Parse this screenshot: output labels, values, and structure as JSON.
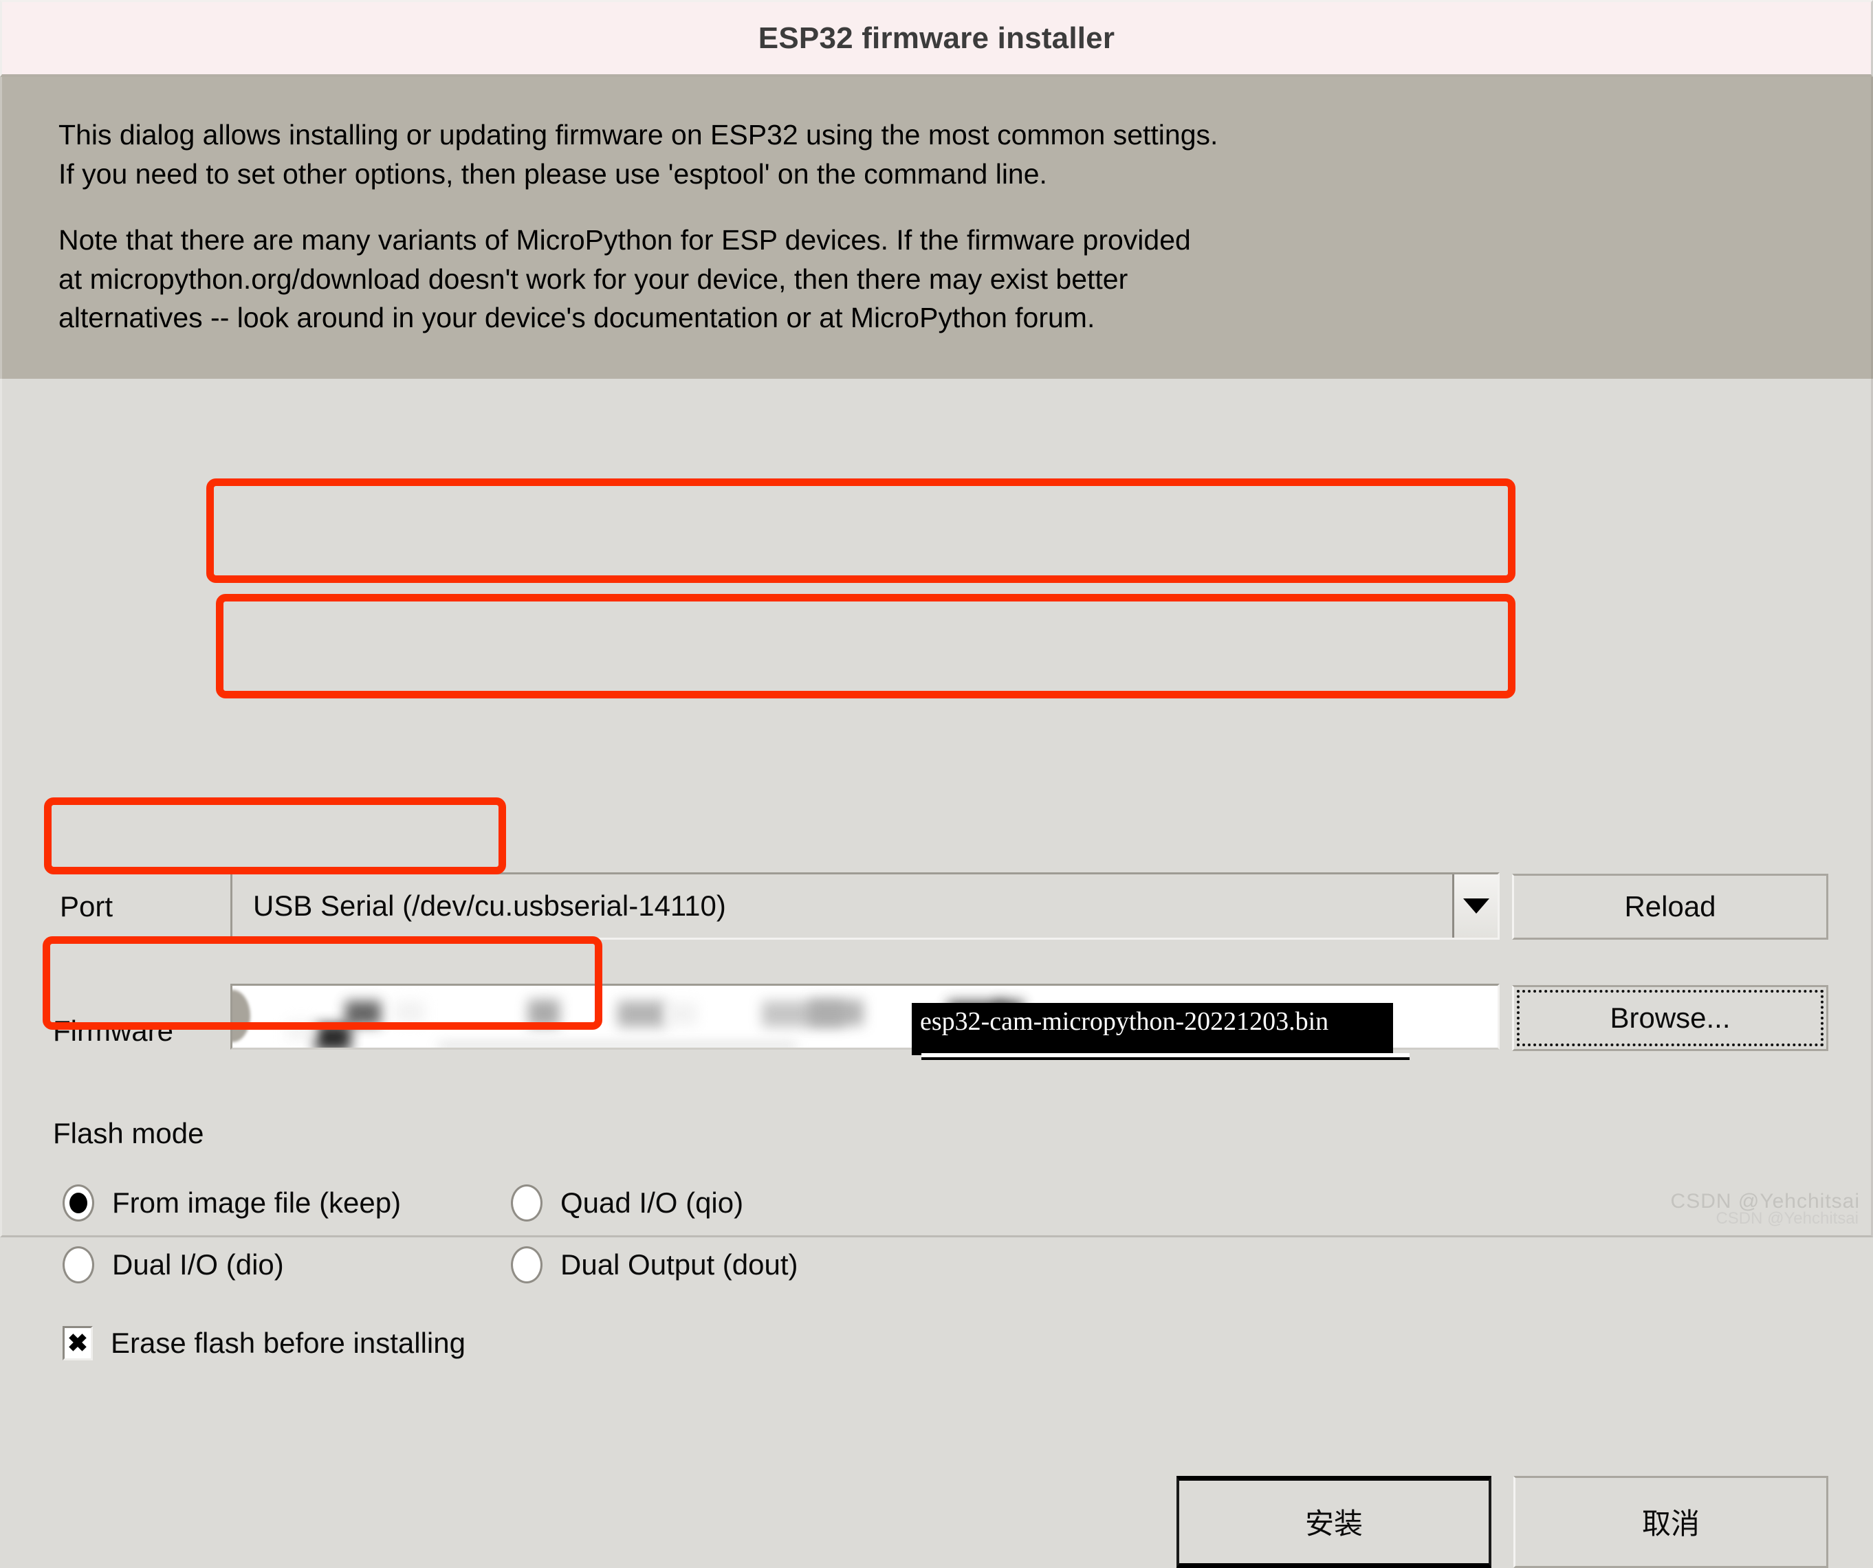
{
  "window": {
    "title": "ESP32 firmware installer"
  },
  "description": {
    "paragraph_1": "This dialog allows installing or updating firmware on ESP32 using the most common settings.\nIf you need to set other options, then please use 'esptool' on the command line.",
    "paragraph_2": "Note that there are many variants of MicroPython for ESP devices. If the firmware provided\nat micropython.org/download doesn't work for your device, then there may exist better\nalternatives -- look around in your device's documentation or at MicroPython forum."
  },
  "form": {
    "port": {
      "label": "Port",
      "value": "USB Serial (/dev/cu.usbserial-14110)",
      "arrow_icon": "chevron-down-icon",
      "reload_button": "Reload"
    },
    "firmware": {
      "label": "Firmware",
      "value": "",
      "tooltip": "esp32-cam-micropython-20221203.bin",
      "browse_button": "Browse..."
    },
    "flash_mode": {
      "label": "Flash mode",
      "options": [
        {
          "label": "From image file (keep)",
          "selected": true
        },
        {
          "label": "Quad I/O (qio)",
          "selected": false
        },
        {
          "label": "Dual I/O (dio)",
          "selected": false
        },
        {
          "label": "Dual Output (dout)",
          "selected": false
        }
      ]
    },
    "erase_flash": {
      "label": "Erase flash before installing",
      "checked": true,
      "mark": "✖"
    }
  },
  "actions": {
    "install_button": "安装",
    "cancel_button": "取消"
  },
  "watermark": {
    "text": "CSDN @Yehchitsai",
    "text_small": "CSDN @Yehchitsai"
  },
  "colors": {
    "titlebar_bg": "#faeff0",
    "description_bg": "#b6b2a8",
    "body_bg": "#dcdbd7",
    "annotation_red": "#fc2d00",
    "tooltip_bg": "#000000",
    "tooltip_fg": "#ffffff"
  }
}
